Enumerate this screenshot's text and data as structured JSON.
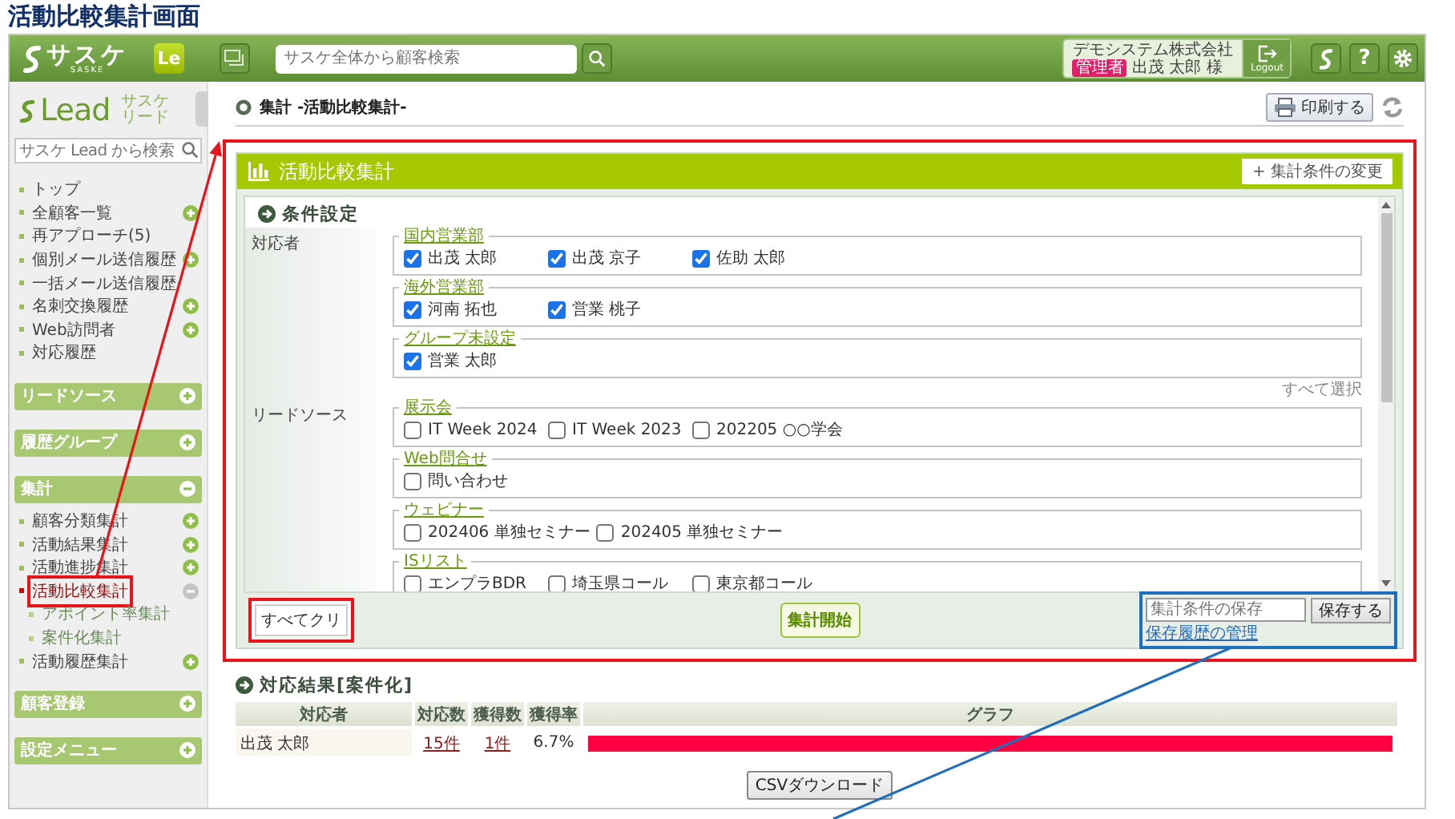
{
  "page_title": "活動比較集計画面",
  "header": {
    "logo": "サスケ",
    "logo_sub": "SASKE",
    "product_badge": "Le",
    "search": {
      "placeholder": "サスケ全体から顧客検索"
    },
    "user": {
      "company": "デモシステム株式会社",
      "role": "管理者",
      "name": "出茂 太郎 様"
    },
    "logout": "Logout",
    "help": "?"
  },
  "sidebar": {
    "brand": "Lead",
    "brand_sub": [
      "サスケ",
      "リード"
    ],
    "search": {
      "placeholder": "サスケ Lead から検索"
    },
    "items": [
      {
        "label": "トップ",
        "expandable": false,
        "selected": false
      },
      {
        "label": "全顧客一覧",
        "expandable": true,
        "expanded": false,
        "selected": false
      },
      {
        "label": "再アプローチ(5)",
        "expandable": false,
        "selected": false
      },
      {
        "label": "個別メール送信履歴",
        "expandable": true,
        "expanded": false,
        "selected": false
      },
      {
        "label": "一括メール送信履歴",
        "expandable": false,
        "selected": false
      },
      {
        "label": "名刺交換履歴",
        "expandable": true,
        "expanded": false,
        "selected": false
      },
      {
        "label": "Web訪問者",
        "expandable": true,
        "expanded": false,
        "selected": false
      },
      {
        "label": "対応履歴",
        "expandable": false,
        "selected": false
      }
    ],
    "sections": [
      {
        "label": "リードソース",
        "expanded": false
      },
      {
        "label": "履歴グループ",
        "expanded": false
      },
      {
        "label": "集計",
        "expanded": true,
        "items": [
          {
            "label": "顧客分類集計",
            "expandable": true,
            "expanded": false,
            "selected": false
          },
          {
            "label": "活動結果集計",
            "expandable": true,
            "expanded": false,
            "selected": false
          },
          {
            "label": "活動進捗集計",
            "expandable": true,
            "expanded": false,
            "selected": false
          },
          {
            "label": "活動比較集計",
            "expandable": true,
            "expanded": true,
            "selected": true,
            "highlighted": true,
            "children": [
              {
                "label": "アポイント率集計",
                "selected": false
              },
              {
                "label": "案件化集計",
                "selected": false
              }
            ]
          },
          {
            "label": "活動履歴集計",
            "expandable": true,
            "expanded": false,
            "selected": false
          }
        ]
      },
      {
        "label": "顧客登録",
        "expanded": false
      },
      {
        "label": "設定メニュー",
        "expanded": false
      }
    ]
  },
  "breadcrumb": "集計 -活動比較集計-",
  "print_button": "印刷する",
  "panel": {
    "title": "活動比較集計",
    "change_button": "+ 集計条件の変更",
    "highlighted": true,
    "section_title": "条件設定",
    "rows": [
      {
        "label": "対応者",
        "select_all": "すべて選択",
        "groups": [
          {
            "name": "国内営業部",
            "options": [
              {
                "label": "出茂 太郎",
                "checked": true
              },
              {
                "label": "出茂 京子",
                "checked": true
              },
              {
                "label": "佐助 太郎",
                "checked": true
              }
            ]
          },
          {
            "name": "海外営業部",
            "options": [
              {
                "label": "河南 拓也",
                "checked": true
              },
              {
                "label": "営業 桃子",
                "checked": true
              }
            ]
          },
          {
            "name": "グループ未設定",
            "options": [
              {
                "label": "営業 太郎",
                "checked": true
              }
            ]
          }
        ]
      },
      {
        "label": "リードソース",
        "groups": [
          {
            "name": "展示会",
            "options": [
              {
                "label": "IT Week 2024",
                "checked": false
              },
              {
                "label": "IT Week 2023",
                "checked": false
              },
              {
                "label": "202205 ○○学会",
                "checked": false
              }
            ]
          },
          {
            "name": "Web問合せ",
            "options": [
              {
                "label": "問い合わせ",
                "checked": false
              }
            ]
          },
          {
            "name": "ウェビナー",
            "options": [
              {
                "label": "202406 単独セミナー",
                "checked": false
              },
              {
                "label": "202405 単独セミナー",
                "checked": false
              }
            ]
          },
          {
            "name": "ISリスト",
            "options": [
              {
                "label": "エンプラBDR",
                "checked": false
              },
              {
                "label": "埼玉県コール",
                "checked": false
              },
              {
                "label": "東京都コール",
                "checked": false
              }
            ]
          }
        ]
      }
    ],
    "clear_button": {
      "label": "すべてクリ",
      "highlighted": true
    },
    "start_button": "集計開始",
    "save": {
      "placeholder": "集計条件の保存",
      "button": "保存する",
      "history_link": "保存履歴の管理",
      "highlighted": true
    }
  },
  "results": {
    "title": "対応結果[案件化]",
    "columns": [
      "対応者",
      "対応数",
      "獲得数",
      "獲得率",
      "グラフ"
    ],
    "rows": [
      {
        "name": "出茂 太郎",
        "count": "15件",
        "won": "1件",
        "rate": "6.7%",
        "level": 1
      }
    ],
    "csv_button": "CSVダウンロード"
  },
  "callouts": [
    {
      "kind": "arrow",
      "color": "#e8141b"
    },
    {
      "kind": "line",
      "color": "#1f6fbf"
    }
  ]
}
